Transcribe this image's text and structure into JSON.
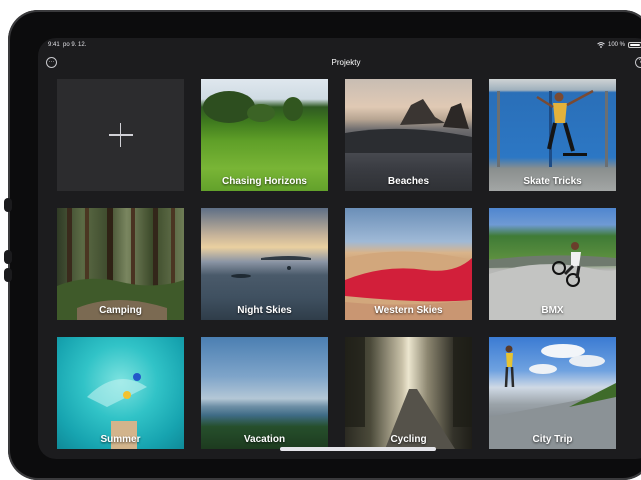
{
  "status": {
    "time": "9:41",
    "date": "po 9. 12.",
    "battery": "100 %"
  },
  "nav": {
    "title": "Projekty",
    "more_icon": "ellipsis-icon",
    "help_icon": "question-icon",
    "more_glyph": "···",
    "help_glyph": "?"
  },
  "new_project": {
    "icon": "plus-icon"
  },
  "projects": [
    {
      "label": "Chasing Horizons"
    },
    {
      "label": "Beaches"
    },
    {
      "label": "Skate Tricks"
    },
    {
      "label": "Camping"
    },
    {
      "label": "Night Skies"
    },
    {
      "label": "Western Skies"
    },
    {
      "label": "BMX"
    },
    {
      "label": "Summer"
    },
    {
      "label": "Vacation"
    },
    {
      "label": "Cycling"
    },
    {
      "label": "City Trip"
    }
  ],
  "colors": {
    "screen_bg": "#1c1c1e",
    "tile_bg": "#2c2c2e",
    "text": "#ffffff"
  }
}
